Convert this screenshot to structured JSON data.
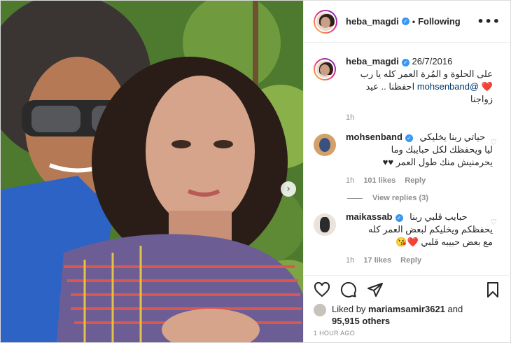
{
  "media": {
    "next_icon": "chevron-right-icon"
  },
  "header": {
    "username": "heba_magdi",
    "verified_icon": "verified-badge-icon",
    "separator": "•",
    "follow_state": "Following",
    "more_icon": "more-options-icon"
  },
  "caption": {
    "username": "heba_magdi",
    "date": "26/7/2016",
    "line1": "على الحلوة و المُرة العمر كله يا رب",
    "line2": "احفظنا .. عيد زواجنا",
    "mention": "@mohsenband",
    "emoji": "❤️",
    "time": "1h"
  },
  "comments": [
    {
      "username": "mohsenband",
      "text_line1": "حياتي ربنا يخليكي",
      "text_line2": "ليا ويحفظك لكل حبايبك وما",
      "text_line3": "يحرمنيش منك طول العمر ♥♥",
      "time": "1h",
      "likes": "101 likes",
      "reply": "Reply"
    },
    {
      "username": "maikassab",
      "text_line1": "حبايب قلبي ربنا",
      "text_line2": "يحفظكم ويخليكم لبعض العمر كله",
      "text_line3": "مع بعض حبيبه قلبي ❤️😘",
      "time": "1h",
      "likes": "17 likes",
      "reply": "Reply"
    }
  ],
  "view_replies": "View replies (3)",
  "actions": {
    "like_icon": "heart-icon",
    "comment_icon": "comment-icon",
    "share_icon": "share-icon",
    "save_icon": "bookmark-icon"
  },
  "liked_by": {
    "prefix": "Liked by ",
    "user": "mariamsamir3621",
    "and": " and",
    "others": "95,915 others"
  },
  "timestamp": "1 HOUR AGO"
}
